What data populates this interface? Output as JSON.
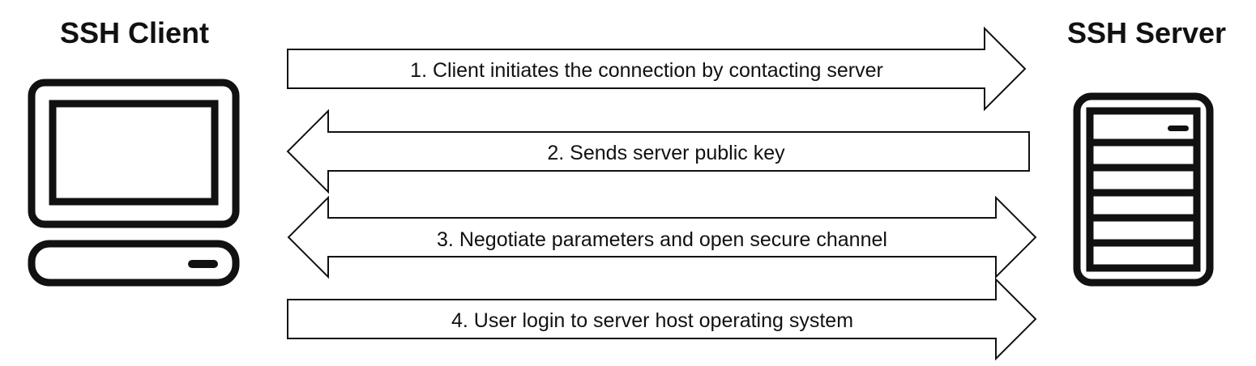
{
  "client": {
    "title": "SSH Client",
    "icon": "computer-icon"
  },
  "server": {
    "title": "SSH Server",
    "icon": "server-icon"
  },
  "steps": [
    {
      "label": "1. Client initiates the connection by contacting server",
      "direction": "right"
    },
    {
      "label": "2. Sends server public key",
      "direction": "left"
    },
    {
      "label": "3. Negotiate parameters and open secure channel",
      "direction": "both"
    },
    {
      "label": "4. User login to server host operating system",
      "direction": "right"
    }
  ],
  "colors": {
    "line": "#111111",
    "background": "#ffffff"
  }
}
